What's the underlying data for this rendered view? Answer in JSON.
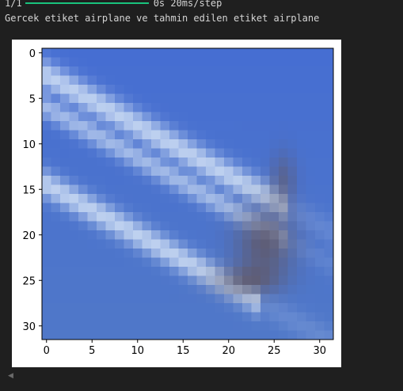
{
  "cell_output": {
    "progress": {
      "step_count": "1/1",
      "fraction_complete": 1.0,
      "timing": "0s 20ms/step"
    },
    "message": "Gercek etiket airplane ve tahmin edilen etiket airplane"
  },
  "colors": {
    "background": "#1f1f1f",
    "progress_fill": "#19c37d",
    "figure_bg": "#ffffff",
    "sky": "#4a6fd0"
  },
  "chart_data": {
    "type": "heatmap",
    "description_of_content": "32x32 RGB image shown with matplotlib imshow",
    "xlim": [
      -0.5,
      31.5
    ],
    "ylim": [
      31.5,
      -0.5
    ],
    "xticks": [
      0,
      5,
      10,
      15,
      20,
      25,
      30
    ],
    "yticks": [
      0,
      5,
      10,
      15,
      20,
      25,
      30
    ],
    "xtick_labels": [
      "0",
      "5",
      "10",
      "15",
      "20",
      "25",
      "30"
    ],
    "ytick_labels": [
      "0",
      "5",
      "10",
      "15",
      "20",
      "25",
      "30"
    ]
  },
  "scrollbar": {
    "left_arrow_icon": "triangle-left-icon"
  }
}
